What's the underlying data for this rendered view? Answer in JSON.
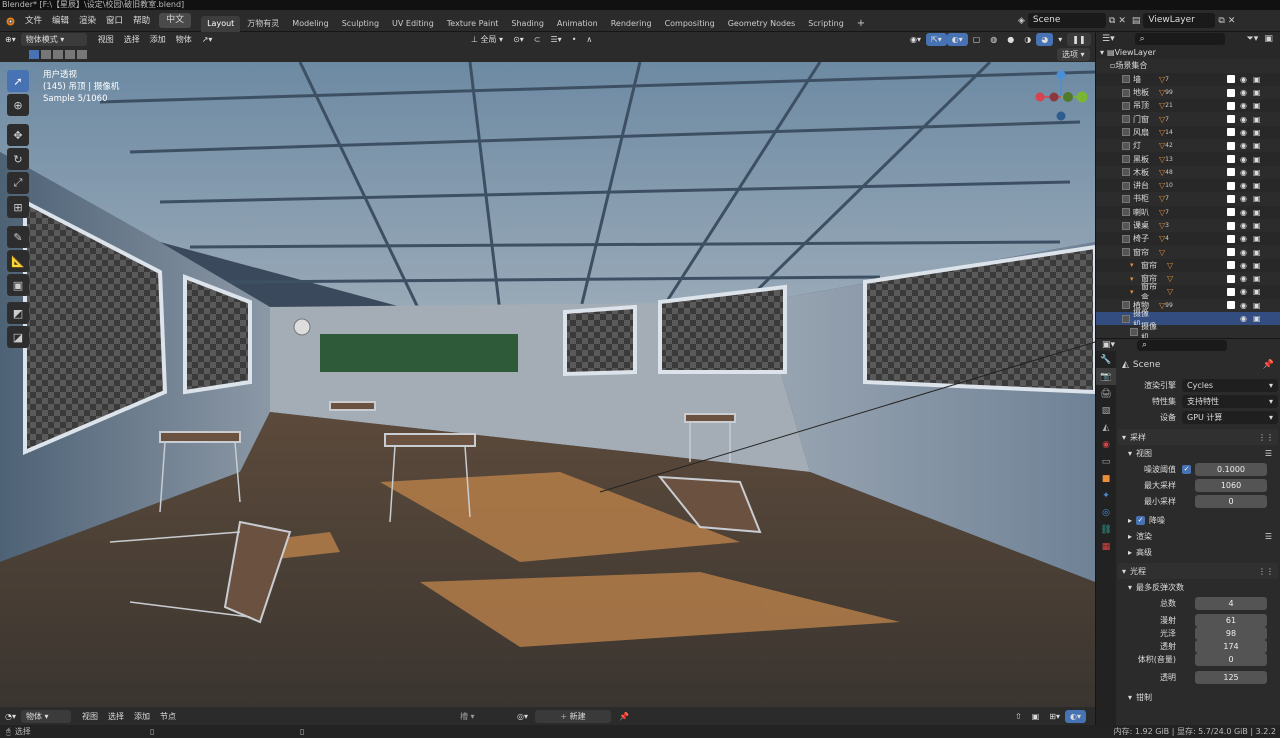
{
  "window_title": "Blender* [F:\\【星辰】\\设定\\校园\\破旧教室.blend]",
  "menu": [
    "文件",
    "编辑",
    "渲染",
    "窗口",
    "帮助"
  ],
  "lang_button": "中文",
  "workspaces": [
    "Layout",
    "万物有灵",
    "Modeling",
    "Sculpting",
    "UV Editing",
    "Texture Paint",
    "Shading",
    "Animation",
    "Rendering",
    "Compositing",
    "Geometry Nodes",
    "Scripting"
  ],
  "active_workspace": "Layout",
  "scene": {
    "name": "Scene"
  },
  "viewlayer": {
    "name": "ViewLayer"
  },
  "viewport_header": {
    "mode": "物体模式",
    "items": [
      "视图",
      "选择",
      "添加",
      "物体"
    ],
    "orientation": "全局",
    "options": "选项"
  },
  "viewport_overlay": {
    "line1": "用户透视",
    "line2": "(145) 吊顶 | 摄像机",
    "line3": "Sample 5/1060"
  },
  "bottom_header": {
    "mode": "物体",
    "items": [
      "视图",
      "选择",
      "添加",
      "节点"
    ],
    "slot": "槽",
    "new": "新建"
  },
  "status": {
    "left": "选择",
    "right": "内存: 1.92 GiB | 显存: 5.7/24.0 GiB | 3.2.2"
  },
  "outliner": {
    "root": "ViewLayer",
    "collection": "场景集合",
    "items": [
      {
        "name": "墙",
        "count": "7"
      },
      {
        "name": "地板",
        "count": "99"
      },
      {
        "name": "吊顶",
        "count": "21"
      },
      {
        "name": "门窗",
        "count": "7"
      },
      {
        "name": "风扇",
        "count": "14"
      },
      {
        "name": "灯",
        "count": "42"
      },
      {
        "name": "黑板",
        "count": "13"
      },
      {
        "name": "木板",
        "count": "48"
      },
      {
        "name": "讲台",
        "count": "10"
      },
      {
        "name": "书柜",
        "count": "7"
      },
      {
        "name": "喇叭",
        "count": "7"
      },
      {
        "name": "课桌",
        "count": "3"
      },
      {
        "name": "椅子",
        "count": "4"
      },
      {
        "name": "窗帘",
        "count": ""
      },
      {
        "name": "窗帘",
        "count": ""
      },
      {
        "name": "窗帘",
        "count": ""
      },
      {
        "name": "窗帘盒",
        "count": ""
      },
      {
        "name": "植物",
        "count": "99"
      },
      {
        "name": "摄像机",
        "count": ""
      },
      {
        "name": "摄像机",
        "count": ""
      }
    ]
  },
  "properties": {
    "scene": "Scene",
    "render_engine_label": "渲染引擎",
    "render_engine": "Cycles",
    "feature_set_label": "特性集",
    "feature_set": "支持特性",
    "device_label": "设备",
    "device": "GPU 计算",
    "sampling": "采样",
    "viewport": "视图",
    "noise_threshold_label": "噪波阈值",
    "noise_threshold": "0.1000",
    "max_samples_label": "最大采样",
    "max_samples": "1060",
    "min_samples_label": "最小采样",
    "min_samples": "0",
    "denoise": "降噪",
    "render": "渲染",
    "advanced": "高级",
    "light_paths": "光程",
    "max_bounces": "最多反弹次数",
    "total_label": "总数",
    "total": "4",
    "diffuse_label": "漫射",
    "diffuse": "61",
    "glossy_label": "光泽",
    "glossy": "98",
    "transmission_label": "透射",
    "transmission": "174",
    "volume_label": "体积(音量)",
    "volume": "0",
    "transparent_label": "透明",
    "transparent": "125",
    "clamping": "钳制"
  }
}
